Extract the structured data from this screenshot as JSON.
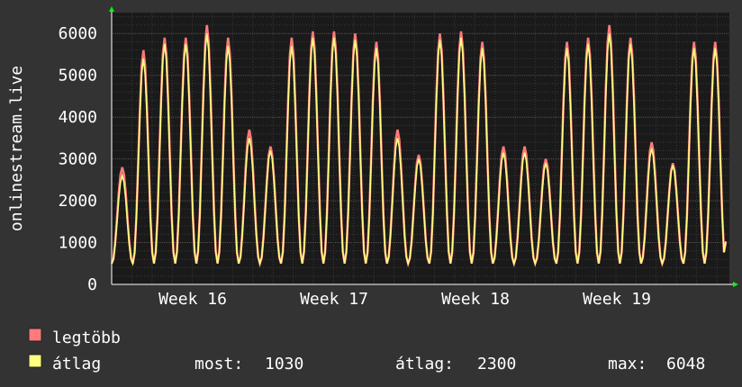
{
  "chart_data": {
    "type": "line",
    "ylabel": "onlinestream.live",
    "ylim": [
      0,
      6500
    ],
    "y_ticks": [
      "0",
      "1000",
      "2000",
      "3000",
      "4000",
      "5000",
      "6000"
    ],
    "x_ticks": [
      "Week 16",
      "Week 17",
      "Week 18",
      "Week 19"
    ],
    "grid": true,
    "colors": {
      "background": "#333333",
      "plot_bg": "#1a1a1a",
      "grid_major": "#555555",
      "grid_minor": "#3a3a3a",
      "max_series": "#ff7a7a",
      "avg_series": "#ffff80",
      "axis_arrow": "#00ff00",
      "text": "#ffffff"
    },
    "series": [
      {
        "name": "legtöbb",
        "color": "#ff7a7a",
        "values": [
          2800,
          5600,
          5900,
          5900,
          6200,
          5900,
          3700,
          3300,
          5900,
          6050,
          6050,
          6000,
          5800,
          3700,
          3100,
          6000,
          6050,
          5800,
          3300,
          3300,
          3000,
          5800,
          5900,
          6200,
          5900,
          3400,
          2900,
          5800,
          5800,
          1000
        ]
      },
      {
        "name": "átlag",
        "color": "#ffff80",
        "values": [
          2600,
          5400,
          5750,
          5750,
          6000,
          5700,
          3500,
          3200,
          5700,
          5900,
          5900,
          5850,
          5650,
          3500,
          3000,
          5850,
          5900,
          5650,
          3150,
          3150,
          2900,
          5650,
          5750,
          6000,
          5750,
          3250,
          2850,
          5650,
          5650,
          1030
        ]
      }
    ],
    "legend": [
      {
        "label": "legtöbb",
        "color": "#ff7a7a"
      },
      {
        "label": "átlag",
        "color": "#ffff80"
      }
    ],
    "stats": {
      "now_label": "most:",
      "now_value": "1030",
      "avg_label": "átlag:",
      "avg_value": "2300",
      "max_label": "max:",
      "max_value": "6048"
    }
  }
}
